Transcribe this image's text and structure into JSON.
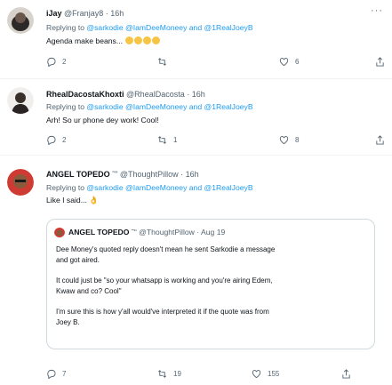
{
  "tweets": [
    {
      "name": "iJay",
      "handle": "@Franjay8",
      "time": "· 16h",
      "replying_prefix": "Replying to ",
      "mentions": "@sarkodie @IamDeeMoneey and @1RealJoeyB",
      "text": "Agenda make beans... ",
      "actions": {
        "reply": "2",
        "retweet": "",
        "like": "6"
      }
    },
    {
      "name": "RhealDacostaKhoxti",
      "handle": "@RhealDacosta",
      "time": "· 16h",
      "replying_prefix": "Replying to ",
      "mentions": "@sarkodie @IamDeeMoneey and @1RealJoeyB",
      "text": "Arh! So ur phone dey work! Cool!",
      "actions": {
        "reply": "2",
        "retweet": "1",
        "like": "8"
      }
    },
    {
      "name": "ANGEL TOPEDO",
      "name_badge": " ˜ʺ",
      "handle": "@ThoughtPillow",
      "time": "· 16h",
      "replying_prefix": "Replying to ",
      "mentions": "@sarkodie @IamDeeMoneey and @1RealJoeyB",
      "text": "Like I said... 👌",
      "quote": {
        "name": "ANGEL TOPEDO",
        "handle": "@ThoughtPillow",
        "time": "· Aug 19",
        "lines": [
          "Dee Money's quoted reply doesn't mean he sent Sarkodie a message",
          "and got aired.",
          "It could just be \"so your whatsapp is working and you're airing Edem,",
          "Kwaw and co? Cool\"",
          "I'm sure this is how y'all would've interpreted it if the quote was from",
          "Joey B."
        ]
      },
      "actions": {
        "reply": "7",
        "retweet": "19",
        "like": "155"
      }
    }
  ],
  "more_icon": "more-dots-icon",
  "colors": {
    "link": "#1d9bf0",
    "muted": "#536471",
    "border": "#eff3f4",
    "emoji": "#f7c546"
  }
}
